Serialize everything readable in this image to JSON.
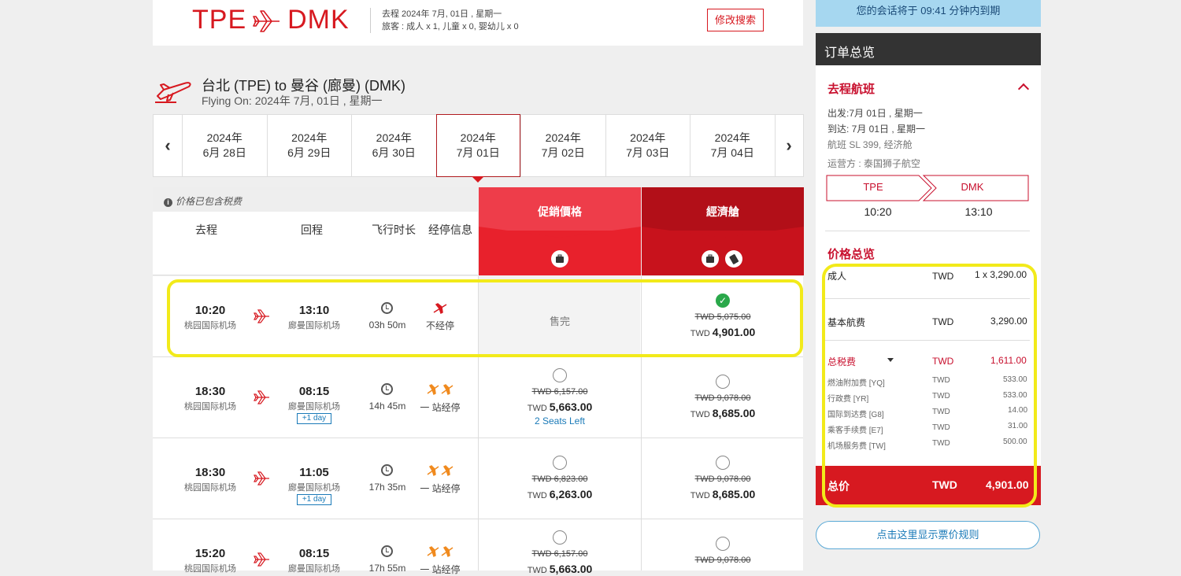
{
  "header": {
    "origin": "TPE",
    "destination": "DMK",
    "trip_line1": "去程 2024年 7月, 01日 , 星期一",
    "trip_line2": "旅客 : 成人 x 1, 儿童 x 0, 婴幼儿 x 0",
    "modify_label": "修改搜索"
  },
  "flying": {
    "title": "台北 (TPE)  to  曼谷 (廊曼) (DMK)",
    "subtitle": "Flying On: 2024年 7月, 01日 , 星期一"
  },
  "dates": [
    {
      "y": "2024年",
      "d": "6月 28日"
    },
    {
      "y": "2024年",
      "d": "6月 29日"
    },
    {
      "y": "2024年",
      "d": "6月 30日"
    },
    {
      "y": "2024年",
      "d": "7月 01日",
      "selected": true
    },
    {
      "y": "2024年",
      "d": "7月 02日"
    },
    {
      "y": "2024年",
      "d": "7月 03日"
    },
    {
      "y": "2024年",
      "d": "7月 04日"
    }
  ],
  "table": {
    "tax_note": "价格已包含税费",
    "col_outbound": "去程",
    "col_return": "回程",
    "col_duration": "飞行时长",
    "col_stops": "经停信息",
    "fare1": "促銷價格",
    "fare2": "經濟艙",
    "colors": {
      "fare1": "#e8212c",
      "fare1_top": "#ee3d4a",
      "fare2": "#c8121c",
      "fare2_top": "#b20f18"
    }
  },
  "rows": [
    {
      "dep": "10:20",
      "dep_apt": "桃园国际机场",
      "arr": "13:10",
      "arr_apt": "廊曼国际机场",
      "plus": "",
      "dur": "03h 50m",
      "stop": "不经停",
      "p1_sold": "售完",
      "p2_old": "TWD 5,075.00",
      "p2_cur": "TWD",
      "p2_new": "4,901.00"
    },
    {
      "dep": "18:30",
      "dep_apt": "桃园国际机场",
      "arr": "08:15",
      "arr_apt": "廊曼国际机场",
      "plus": "+1 day",
      "dur": "14h 45m",
      "stop": "一 站经停",
      "p1_old": "TWD 6,157.00",
      "p1_cur": "TWD",
      "p1_new": "5,663.00",
      "seats": "2 Seats Left",
      "p2_old": "TWD 9,078.00",
      "p2_cur": "TWD",
      "p2_new": "8,685.00"
    },
    {
      "dep": "18:30",
      "dep_apt": "桃园国际机场",
      "arr": "11:05",
      "arr_apt": "廊曼国际机场",
      "plus": "+1 day",
      "dur": "17h 35m",
      "stop": "一 站经停",
      "p1_old": "TWD 6,823.00",
      "p1_cur": "TWD",
      "p1_new": "6,263.00",
      "p2_old": "TWD 9,078.00",
      "p2_cur": "TWD",
      "p2_new": "8,685.00"
    },
    {
      "dep": "15:20",
      "dep_apt": "桃园国际机场",
      "arr": "08:15",
      "arr_apt": "廊曼国际机场",
      "plus": "",
      "dur": "17h 55m",
      "stop": "一 站经停",
      "p1_old": "TWD 6,157.00",
      "p1_cur": "TWD",
      "p1_new": "5,663.00",
      "p2_old": "TWD 9,078.00"
    }
  ],
  "session": "您的会话将于 09:41 分钟内到期",
  "summary": {
    "title": "订单总览",
    "outbound": "去程航班",
    "depart": "出发:7月 01日 , 星期一",
    "arrive": "到达: 7月 01日 , 星期一",
    "flight": "航班 SL 399, 经济舱",
    "operator": "运营方 :  泰国狮子航空",
    "from": "TPE",
    "to": "DMK",
    "dep_time": "10:20",
    "arr_time": "13:10",
    "price_title": "价格总览",
    "adult": "成人",
    "adult_cur": "TWD",
    "adult_val": "1 x 3,290.00",
    "base": "基本航费",
    "base_cur": "TWD",
    "base_val": "3,290.00",
    "tax": "总税费",
    "tax_cur": "TWD",
    "tax_val": "1,611.00",
    "taxes": [
      {
        "n": "燃油附加费 [YQ]",
        "c": "TWD",
        "v": "533.00"
      },
      {
        "n": "行政费 [YR]",
        "c": "TWD",
        "v": "533.00"
      },
      {
        "n": "国际到达费 [G8]",
        "c": "TWD",
        "v": "14.00"
      },
      {
        "n": "乘客手续费 [E7]",
        "c": "TWD",
        "v": "31.00"
      },
      {
        "n": "机场服务费 [TW]",
        "c": "TWD",
        "v": "500.00"
      }
    ],
    "total": "总价",
    "total_cur": "TWD",
    "total_val": "4,901.00",
    "rules": "点击这里显示票价规则"
  }
}
